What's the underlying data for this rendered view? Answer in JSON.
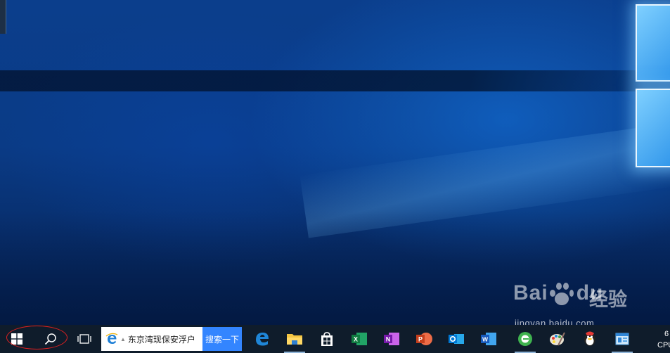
{
  "desktop": {
    "wallpaper": "windows-10-hero-wallpaper"
  },
  "watermark": {
    "logo_text": "Bai",
    "logo_suffix": "du",
    "jingyan_text": "经验",
    "url": "jingyan.baidu.com"
  },
  "taskbar": {
    "start_icon": "windows-start-icon",
    "search_icon": "search-icon",
    "taskview_icon": "task-view-icon",
    "search_box": {
      "icon": "ie-icon",
      "query": "东京湾现保安浮户",
      "button_label": "搜索一下"
    },
    "apps": [
      {
        "name": "edge",
        "icon": "edge-icon",
        "active": false
      },
      {
        "name": "file-explorer",
        "icon": "folder-icon",
        "active": true
      },
      {
        "name": "store",
        "icon": "store-icon",
        "active": false
      },
      {
        "name": "excel",
        "icon": "excel-icon",
        "active": false
      },
      {
        "name": "onenote",
        "icon": "onenote-icon",
        "active": false
      },
      {
        "name": "powerpoint",
        "icon": "powerpoint-icon",
        "active": false
      },
      {
        "name": "outlook",
        "icon": "outlook-icon",
        "active": false
      },
      {
        "name": "word",
        "icon": "word-icon",
        "active": false
      },
      {
        "name": "green-browser",
        "icon": "green-browser-icon",
        "active": true
      },
      {
        "name": "paint",
        "icon": "paint-icon",
        "active": false
      },
      {
        "name": "qq-game",
        "icon": "qq-penguin-icon",
        "active": false
      },
      {
        "name": "settings-app",
        "icon": "app-window-icon",
        "active": true
      }
    ],
    "tray": {
      "line1": "6",
      "line2": "CPU"
    }
  },
  "colors": {
    "taskbar": "#0f1c2b",
    "search_button": "#3385ff",
    "highlight_oval": "#e02020"
  }
}
